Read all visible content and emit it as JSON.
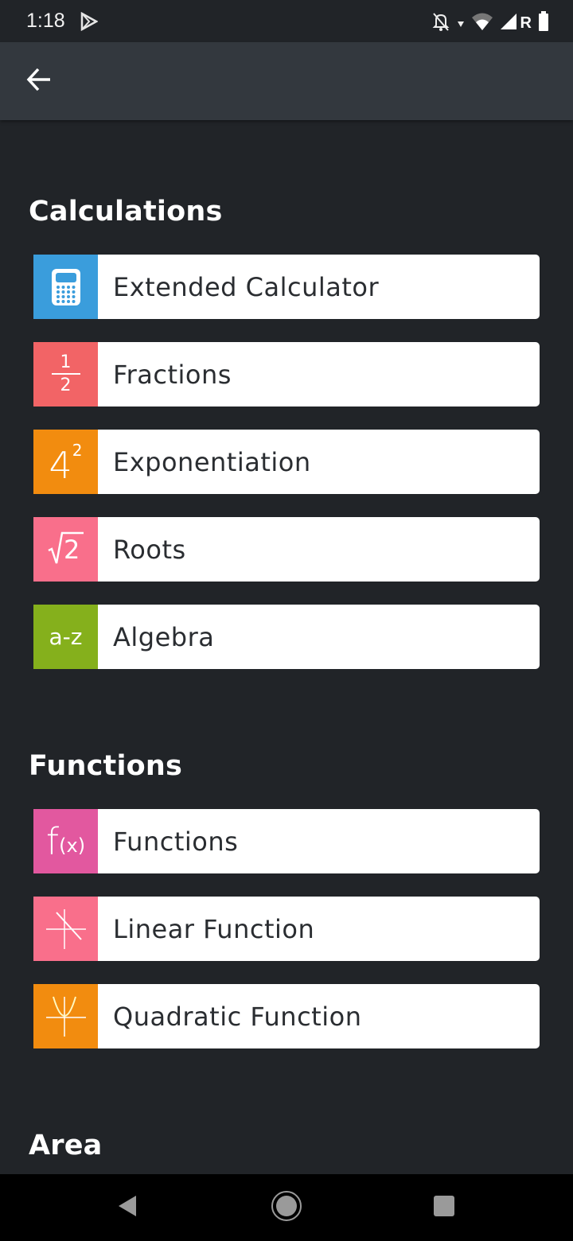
{
  "status_bar": {
    "time": "1:18",
    "icons": [
      "play-store-icon",
      "notifications-off-icon",
      "wifi-icon",
      "signal-icon",
      "roaming-icon",
      "battery-icon"
    ],
    "roaming_label": "R"
  },
  "app_bar": {
    "back_icon": "arrow-left-icon"
  },
  "sections": [
    {
      "title": "Calculations",
      "items": [
        {
          "label": "Extended Calculator",
          "icon": "calculator-icon",
          "color": "#3a9ddc"
        },
        {
          "label": "Fractions",
          "icon": "fraction-icon",
          "icon_text_num": "1",
          "icon_text_den": "2",
          "color": "#f26466"
        },
        {
          "label": "Exponentiation",
          "icon": "exponent-icon",
          "icon_text_base": "4",
          "icon_text_exp": "2",
          "color": "#f28c0f"
        },
        {
          "label": "Roots",
          "icon": "root-icon",
          "icon_text": "2",
          "color": "#f96f8b"
        },
        {
          "label": "Algebra",
          "icon": "algebra-icon",
          "icon_text": "a-z",
          "color": "#85b01c"
        }
      ]
    },
    {
      "title": "Functions",
      "items": [
        {
          "label": "Functions",
          "icon": "function-icon",
          "icon_text_f": "f",
          "icon_text_x": "(x)",
          "color": "#e2589f"
        },
        {
          "label": "Linear Function",
          "icon": "linear-graph-icon",
          "color": "#f96f8b"
        },
        {
          "label": "Quadratic Function",
          "icon": "parabola-graph-icon",
          "color": "#f28c0f"
        }
      ]
    },
    {
      "title": "Area",
      "items": []
    }
  ],
  "nav_bar": {
    "back": "nav-back-icon",
    "home": "nav-home-icon",
    "recents": "nav-recents-icon"
  }
}
